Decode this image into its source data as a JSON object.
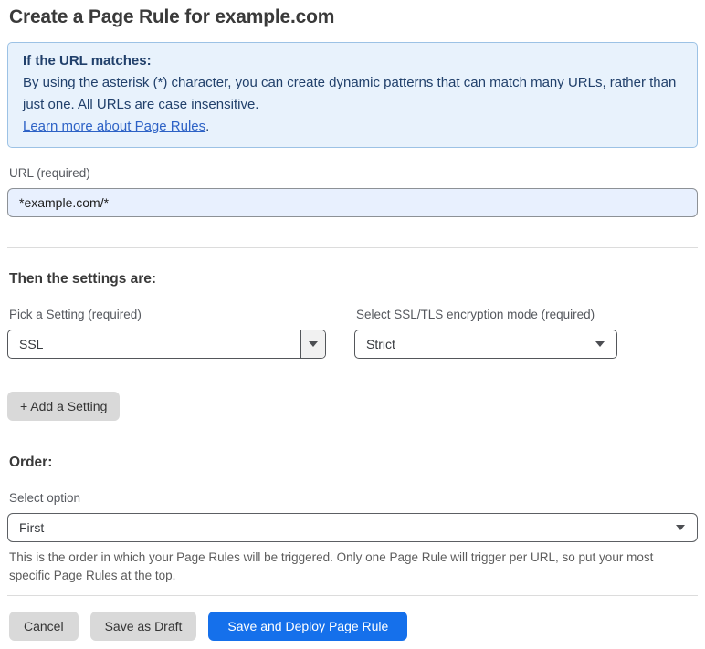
{
  "page": {
    "title": "Create a Page Rule for example.com"
  },
  "info_box": {
    "heading": "If the URL matches:",
    "body": "By using the asterisk (*) character, you can create dynamic patterns that can match many URLs, rather than just one. All URLs are case insensitive.",
    "link_label": "Learn more about Page Rules",
    "link_suffix": "."
  },
  "url_field": {
    "label": "URL (required)",
    "value": "*example.com/*"
  },
  "settings_section": {
    "heading": "Then the settings are:",
    "setting_select": {
      "label": "Pick a Setting (required)",
      "value": "SSL"
    },
    "mode_select": {
      "label": "Select SSL/TLS encryption mode (required)",
      "value": "Strict"
    },
    "add_setting_label": "+ Add a Setting"
  },
  "order_section": {
    "heading": "Order:",
    "select_label": "Select option",
    "select_value": "First",
    "helper_text": "This is the order in which your Page Rules will be triggered. Only one Page Rule will trigger per URL, so put your most specific Page Rules at the top."
  },
  "actions": {
    "cancel_label": "Cancel",
    "save_draft_label": "Save as Draft",
    "save_deploy_label": "Save and Deploy Page Rule"
  },
  "icons": {
    "dropdown_arrow": "caret-down-icon"
  },
  "colors": {
    "accent_blue": "#1570eb",
    "info_box_bg": "#e8f2fc",
    "info_box_border": "#9cc2e5",
    "info_text": "#21406b",
    "link_blue": "#2d62c6",
    "input_autofill_bg": "#e8f0fe",
    "gray_button_bg": "#d9d9d9"
  }
}
